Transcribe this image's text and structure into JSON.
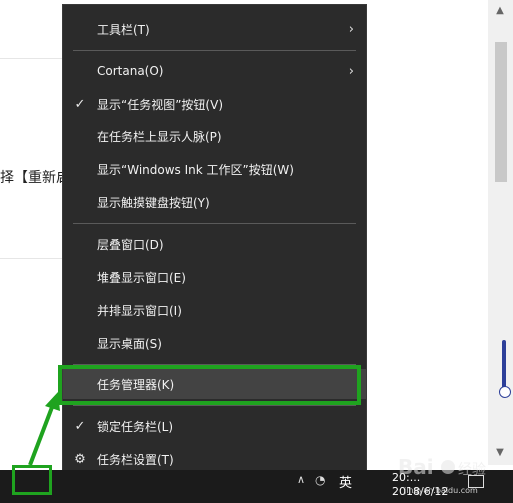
{
  "background": {
    "visible_text": "择【重新启"
  },
  "context_menu": {
    "items": [
      {
        "label": "工具栏(T)",
        "leading": "",
        "trailing": "›"
      },
      {
        "label": "Cortana(O)",
        "leading": "",
        "trailing": "›"
      },
      {
        "label": "显示“任务视图”按钮(V)",
        "leading": "✓",
        "trailing": ""
      },
      {
        "label": "在任务栏上显示人脉(P)",
        "leading": "",
        "trailing": ""
      },
      {
        "label": "显示“Windows Ink 工作区”按钮(W)",
        "leading": "",
        "trailing": ""
      },
      {
        "label": "显示触摸键盘按钮(Y)",
        "leading": "",
        "trailing": ""
      },
      {
        "label": "层叠窗口(D)",
        "leading": "",
        "trailing": ""
      },
      {
        "label": "堆叠显示窗口(E)",
        "leading": "",
        "trailing": ""
      },
      {
        "label": "并排显示窗口(I)",
        "leading": "",
        "trailing": ""
      },
      {
        "label": "显示桌面(S)",
        "leading": "",
        "trailing": ""
      },
      {
        "label": "任务管理器(K)",
        "leading": "",
        "trailing": ""
      },
      {
        "label": "锁定任务栏(L)",
        "leading": "✓",
        "trailing": ""
      },
      {
        "label": "任务栏设置(T)",
        "leading": "⚙",
        "trailing": ""
      }
    ],
    "highlighted_index": 10
  },
  "taskbar": {
    "ime_label": "英",
    "time": "20:...",
    "date": "2018/6/12"
  },
  "watermark": {
    "url": "jingyan.baidu.com"
  },
  "colors": {
    "menu_bg": "#2b2b2b",
    "annotation_green": "#1fa31f",
    "taskbar_bg": "#1b1b1b"
  }
}
